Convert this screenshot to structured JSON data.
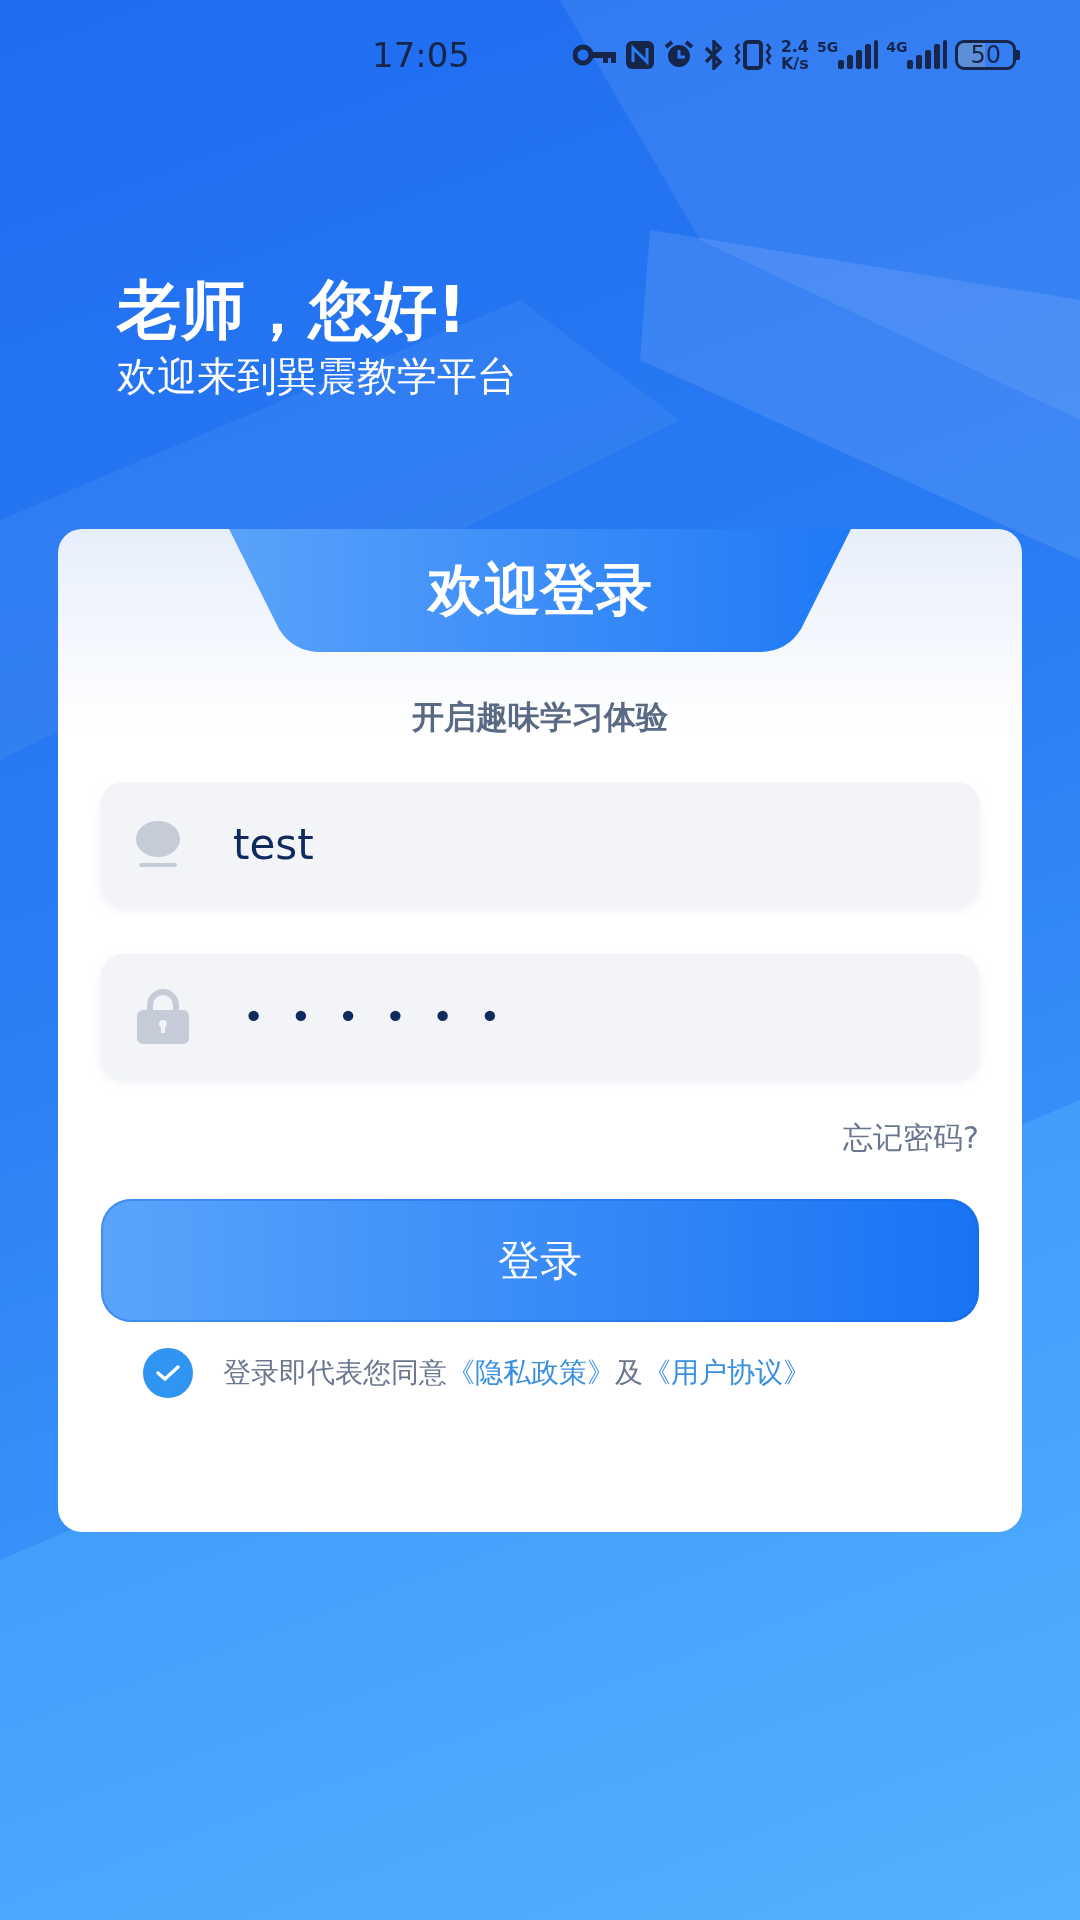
{
  "status_bar": {
    "time": "17:05",
    "net_speed": [
      "2.4",
      "K/s"
    ],
    "signals": [
      "5G",
      "4G"
    ],
    "battery": "50"
  },
  "greeting": {
    "title": "老师，您好!",
    "subtitle": "欢迎来到巽震教学平台"
  },
  "card": {
    "title": "欢迎登录",
    "tagline": "开启趣味学习体验",
    "username": {
      "value": "test"
    },
    "password": {
      "value": "••••••"
    },
    "forgot": "忘记密码?",
    "login_button": "登录",
    "agreement": {
      "checked": true,
      "parts": [
        {
          "kind": "text",
          "text": "登录即代表您同意"
        },
        {
          "kind": "link",
          "text": "《隐私政策》"
        },
        {
          "kind": "text",
          "text": "及"
        },
        {
          "kind": "link",
          "text": "《用户协议》"
        }
      ]
    }
  }
}
